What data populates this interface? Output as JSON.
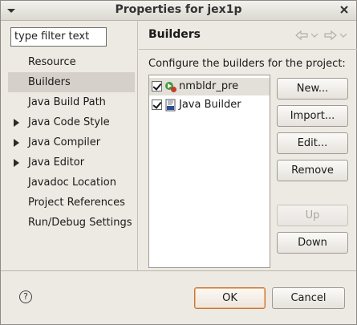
{
  "window": {
    "title": "Properties for jex1p"
  },
  "filter": {
    "value": "type filter text"
  },
  "tree": {
    "items": [
      {
        "label": "Resource",
        "expandable": false,
        "selected": false
      },
      {
        "label": "Builders",
        "expandable": false,
        "selected": true
      },
      {
        "label": "Java Build Path",
        "expandable": false,
        "selected": false
      },
      {
        "label": "Java Code Style",
        "expandable": true,
        "selected": false
      },
      {
        "label": "Java Compiler",
        "expandable": true,
        "selected": false
      },
      {
        "label": "Java Editor",
        "expandable": true,
        "selected": false
      },
      {
        "label": "Javadoc Location",
        "expandable": false,
        "selected": false
      },
      {
        "label": "Project References",
        "expandable": false,
        "selected": false
      },
      {
        "label": "Run/Debug Settings",
        "expandable": false,
        "selected": false
      }
    ]
  },
  "page": {
    "title": "Builders",
    "description": "Configure the builders for the project:"
  },
  "builders": [
    {
      "label": "nmbldr_pre",
      "checked": true,
      "icon": "external-tool-builder-icon"
    },
    {
      "label": "Java Builder",
      "checked": true,
      "icon": "java-builder-icon"
    }
  ],
  "buttons": {
    "new": "New...",
    "import": "Import...",
    "edit": "Edit...",
    "remove": "Remove",
    "up": "Up",
    "down": "Down"
  },
  "footer": {
    "ok": "OK",
    "cancel": "Cancel",
    "help": "?"
  },
  "colors": {
    "ok_border": "#c87733",
    "selection": "#d5d1ca"
  }
}
